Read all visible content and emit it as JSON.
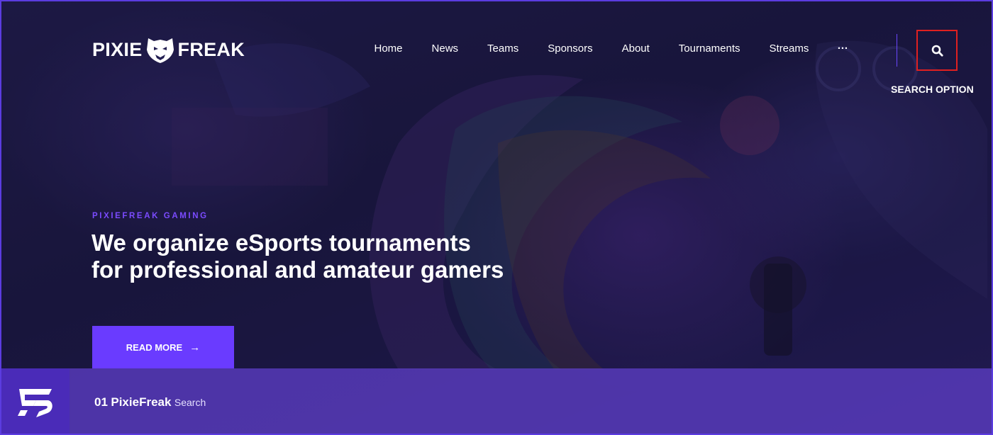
{
  "brand": {
    "logo_left": "PIXIE",
    "logo_right": "FREAK"
  },
  "nav": {
    "items": [
      {
        "label": "Home"
      },
      {
        "label": "News"
      },
      {
        "label": "Teams"
      },
      {
        "label": "Sponsors"
      },
      {
        "label": "About"
      },
      {
        "label": "Tournaments"
      },
      {
        "label": "Streams"
      }
    ],
    "more_label": "···",
    "search_caption": "SEARCH OPTION"
  },
  "hero": {
    "eyebrow": "PIXIEFREAK GAMING",
    "headline_line1": "We organize eSports tournaments",
    "headline_line2": "for professional and amateur gamers",
    "cta_label": "READ MORE",
    "cta_arrow": "→"
  },
  "bottom_bar": {
    "number": "01",
    "name": "PixieFreak",
    "subtitle": "Search"
  },
  "colors": {
    "accent": "#6a3bff",
    "highlight_border": "#e02020",
    "bar": "#5c3ec4"
  }
}
